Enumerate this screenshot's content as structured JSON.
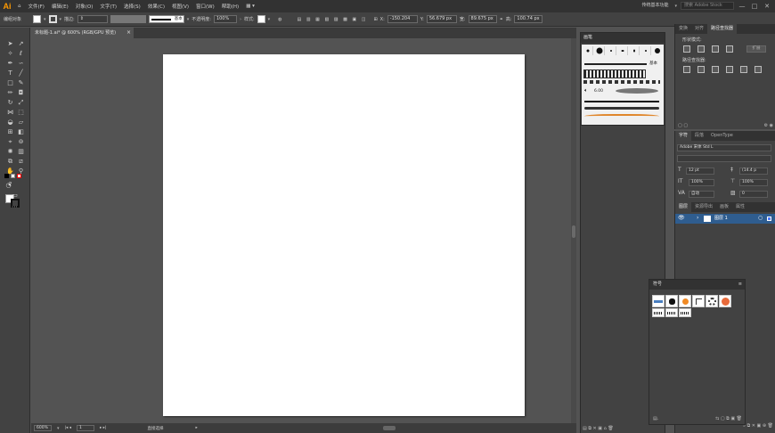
{
  "app": {
    "logo": "Ai"
  },
  "menubar": {
    "items": [
      "文件(F)",
      "编辑(E)",
      "对象(O)",
      "文字(T)",
      "选择(S)",
      "效果(C)",
      "视图(V)",
      "窗口(W)",
      "帮助(H)"
    ],
    "workspace": "传统基本功能",
    "search_placeholder": "搜索 Adobe Stock",
    "win_min": "—",
    "win_max": "□",
    "win_close": "✕"
  },
  "controlbar": {
    "selection": "编组对象",
    "stroke_label": "描边:",
    "stroke_style": "基本",
    "opacity_label": "不透明度:",
    "opacity_value": "100%",
    "style_label": "样式:",
    "x_label": "X:",
    "x_value": "-150.204",
    "y_label": "Y:",
    "y_value": "56.679 px",
    "w_label": "宽:",
    "w_value": "89.675 px",
    "h_label": "高:",
    "h_value": "100.74 px"
  },
  "document": {
    "tab_title": "未标题-1.ai* @ 600% (RGB/GPU 预览)",
    "tab_close": "×"
  },
  "statusbar": {
    "zoom": "600%",
    "page": "1",
    "tool_name": "直接选择"
  },
  "brushes": {
    "title": "画笔",
    "basic_label": "基本",
    "size_label": "6.00"
  },
  "pathfinder": {
    "tabs": [
      "变换",
      "对齐",
      "路径查找器"
    ],
    "shape_modes": "形状模式:",
    "pathfinder_label": "路径查找器:",
    "expand": "扩展"
  },
  "character": {
    "tabs": [
      "字符",
      "段落",
      "OpenType"
    ],
    "font_family": "Adobe 宋体 Std L",
    "font_size": "12 pt",
    "leading": "(14.4 p",
    "scale_v": "100%",
    "scale_h": "100%",
    "kerning": "自动",
    "tracking": "0"
  },
  "layers": {
    "tabs": [
      "图层",
      "资源导出",
      "画板",
      "属性"
    ],
    "layer_name": "图层 1"
  },
  "symbols": {
    "title": "符号"
  }
}
